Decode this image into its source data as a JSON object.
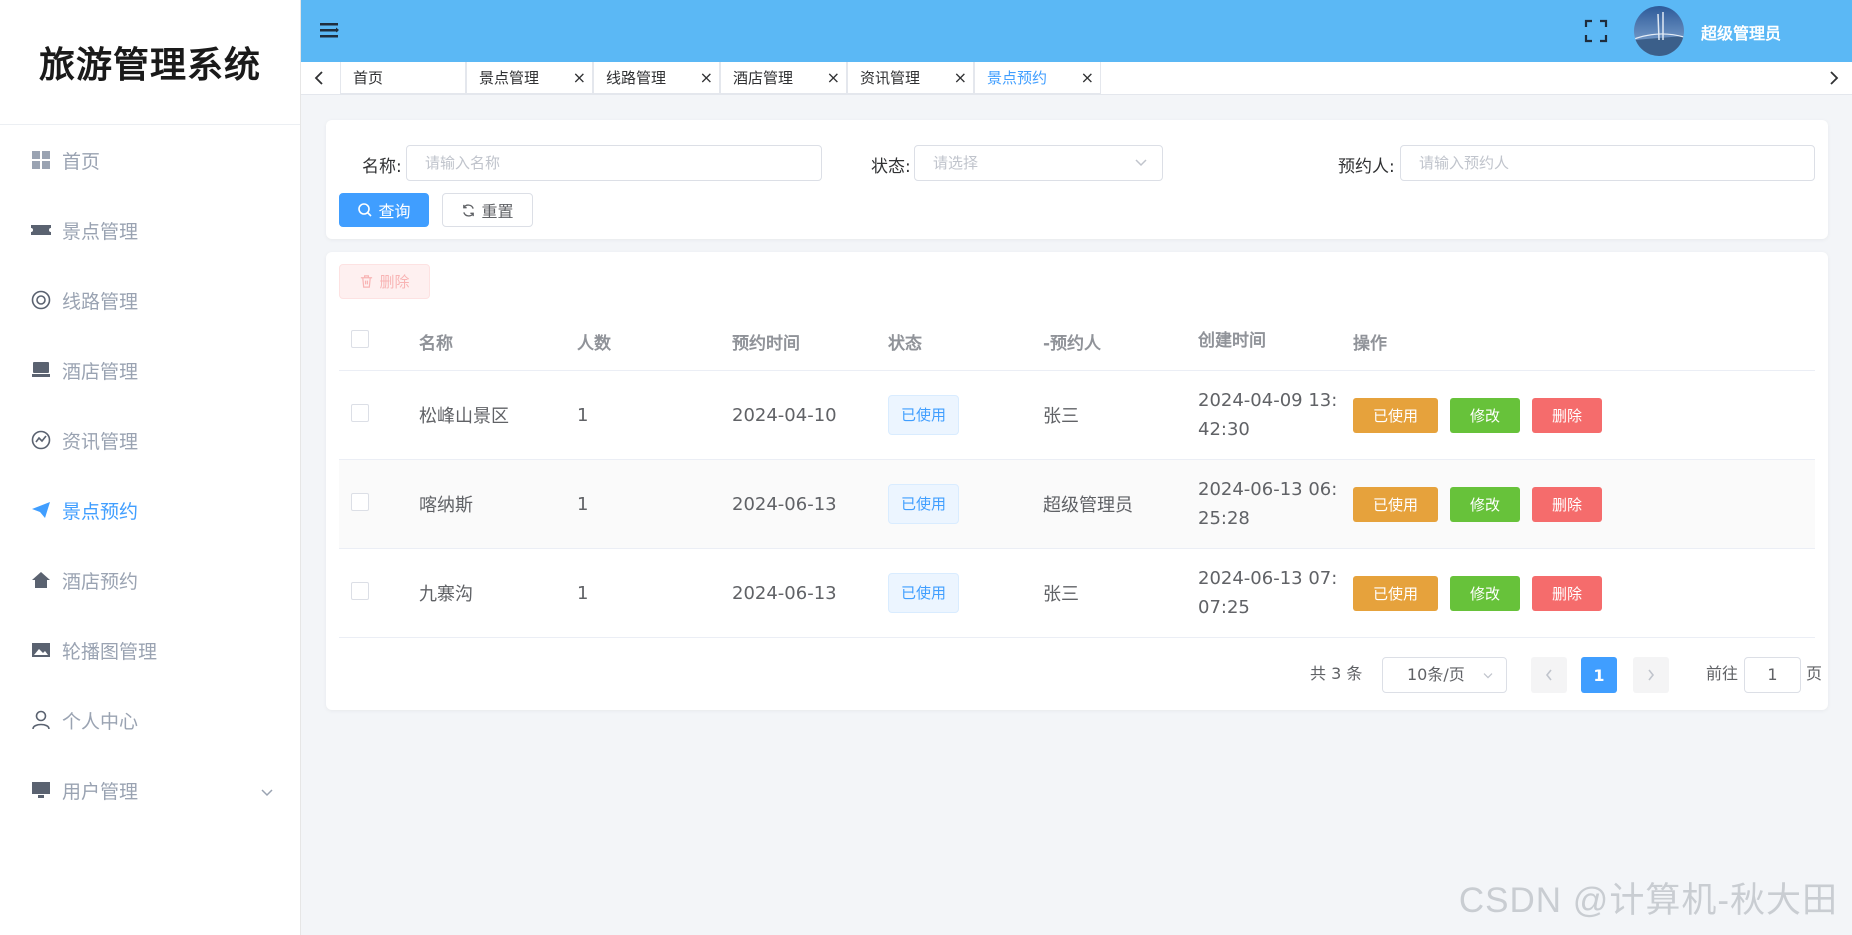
{
  "app": {
    "title": "旅游管理系统"
  },
  "sidebar": {
    "items": [
      {
        "label": "首页",
        "icon": "dashboard-grid-icon"
      },
      {
        "label": "景点管理",
        "icon": "ticket-icon"
      },
      {
        "label": "线路管理",
        "icon": "lifebuoy-icon"
      },
      {
        "label": "酒店管理",
        "icon": "hotel-icon"
      },
      {
        "label": "资讯管理",
        "icon": "news-icon"
      },
      {
        "label": "景点预约",
        "icon": "paper-plane-icon",
        "active": true
      },
      {
        "label": "酒店预约",
        "icon": "home-icon"
      },
      {
        "label": "轮播图管理",
        "icon": "image-icon"
      },
      {
        "label": "个人中心",
        "icon": "user-icon"
      },
      {
        "label": "用户管理",
        "icon": "monitor-icon"
      }
    ]
  },
  "header": {
    "username": "超级管理员"
  },
  "tabs": [
    {
      "label": "首页"
    },
    {
      "label": "景点管理"
    },
    {
      "label": "线路管理"
    },
    {
      "label": "酒店管理"
    },
    {
      "label": "资讯管理"
    },
    {
      "label": "景点预约",
      "active": true
    }
  ],
  "search": {
    "name_label": "名称:",
    "name_placeholder": "请输入名称",
    "status_label": "状态:",
    "status_placeholder": "请选择",
    "booker_label": "预约人:",
    "booker_placeholder": "请输入预约人",
    "query_label": "查询",
    "reset_label": "重置"
  },
  "toolbar": {
    "delete_label": "删除"
  },
  "table": {
    "headers": [
      "名称",
      "人数",
      "预约时间",
      "状态",
      "-预约人",
      "创建时间",
      "操作"
    ],
    "rows": [
      {
        "name": "松峰山景区",
        "count": "1",
        "date": "2024-04-10",
        "status": "已使用",
        "booker": "张三",
        "created_line1": "2024-04-09 13:",
        "created_line2": "42:30"
      },
      {
        "name": "喀纳斯",
        "count": "1",
        "date": "2024-06-13",
        "status": "已使用",
        "booker": "超级管理员",
        "created_line1": "2024-06-13 06:",
        "created_line2": "25:28"
      },
      {
        "name": "九寨沟",
        "count": "1",
        "date": "2024-06-13",
        "status": "已使用",
        "booker": "张三",
        "created_line1": "2024-06-13 07:",
        "created_line2": "07:25"
      }
    ],
    "op_used": "已使用",
    "op_edit": "修改",
    "op_delete": "删除"
  },
  "pagination": {
    "total": "共 3 条",
    "page_size": "10条/页",
    "current_page": "1",
    "goto_label": "前往",
    "goto_value": "1",
    "page_suffix": "页"
  },
  "watermark": "CSDN @计算机-秋大田",
  "colors": {
    "header_bg": "#5bb8f5",
    "primary": "#409eff",
    "warning": "#e6a23c",
    "success": "#67c23a",
    "danger": "#f56c6c"
  }
}
